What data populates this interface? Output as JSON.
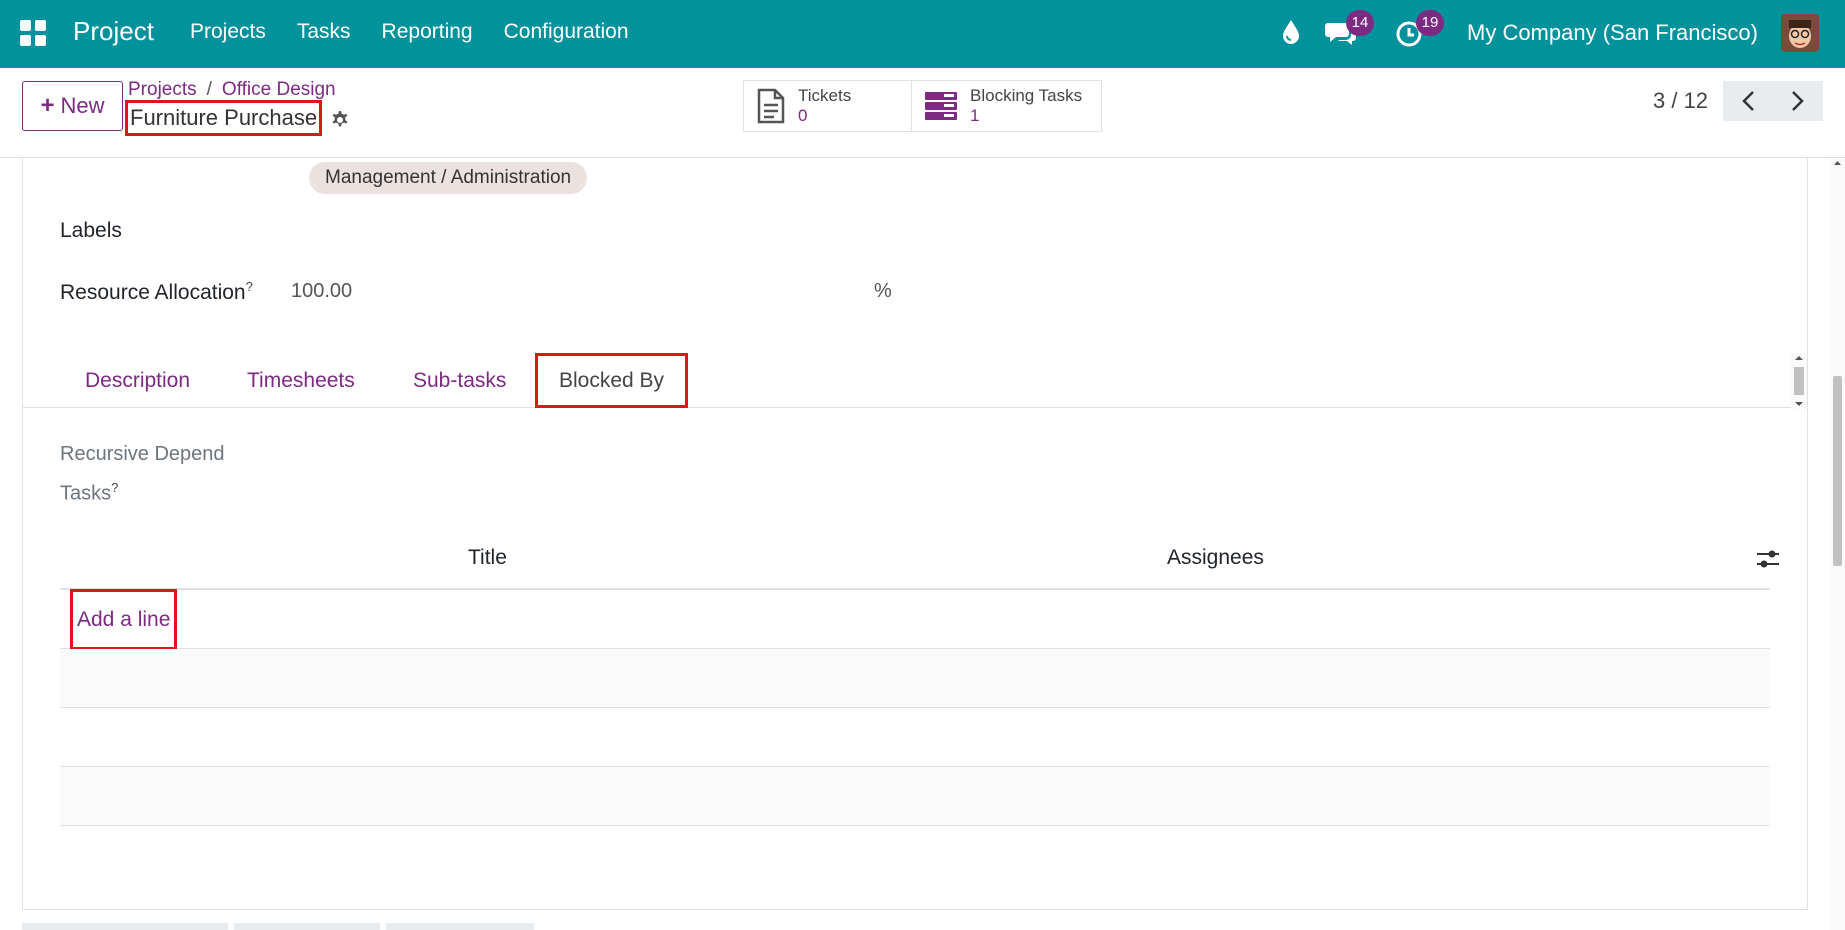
{
  "navbar": {
    "app_title": "Project",
    "menu": [
      "Projects",
      "Tasks",
      "Reporting",
      "Configuration"
    ],
    "messages_count": "14",
    "activities_count": "19",
    "company": "My Company (San Francisco)"
  },
  "control": {
    "new_label": "New",
    "breadcrumb": [
      "Projects",
      "Office Design"
    ],
    "record_name": "Furniture Purchase",
    "smart_buttons": [
      {
        "label": "Tickets",
        "value": "0"
      },
      {
        "label": "Blocking Tasks",
        "value": "1"
      }
    ],
    "pager": "3 / 12"
  },
  "form": {
    "tag": "Management / Administration",
    "labels_label": "Labels",
    "resource_allocation_label": "Resource Allocation",
    "resource_allocation_help": "?",
    "resource_allocation_value": "100.00",
    "resource_allocation_unit": "%",
    "tabs": [
      "Description",
      "Timesheets",
      "Sub-tasks",
      "Blocked By"
    ],
    "active_tab": "Blocked By",
    "recursive_label_line1": "Recursive Depend",
    "recursive_label_line2": "Tasks",
    "recursive_help": "?",
    "table": {
      "columns": [
        "Title",
        "Assignees"
      ],
      "add_line": "Add a line"
    }
  },
  "colors": {
    "navbar": "#01929c",
    "accent": "#7c2a82",
    "highlight": "#e01515"
  }
}
